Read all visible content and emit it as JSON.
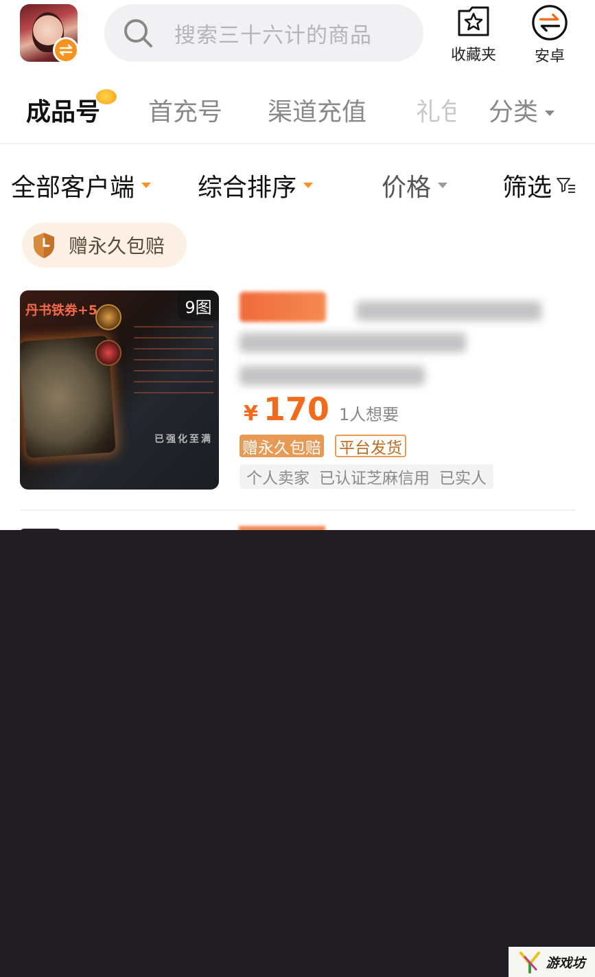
{
  "header": {
    "search_placeholder": "搜索三十六计的商品",
    "favorites_label": "收藏夹",
    "platform_label": "安卓"
  },
  "tabs": [
    {
      "label": "成品号",
      "active": true
    },
    {
      "label": "首充号",
      "active": false
    },
    {
      "label": "渠道充值",
      "active": false
    },
    {
      "label": "礼包",
      "active": false
    },
    {
      "label": "分类",
      "active": false
    }
  ],
  "filters": {
    "client": "全部客户端",
    "sort": "综合排序",
    "price": "价格",
    "filter": "筛选"
  },
  "guarantee_chip": "赠永久包赔",
  "listing": {
    "image_count": "9图",
    "image_header": "丹书铁券+5",
    "image_caption": "已强化至满",
    "currency": "¥",
    "price": "170",
    "wants": "1人想要",
    "badges": [
      "赠永久包赔",
      "平台发货"
    ],
    "seller_tags": [
      "个人卖家",
      "已认证芝麻信用",
      "已实人"
    ]
  },
  "watermark": "游戏坊",
  "colors": {
    "accent": "#f26a1b",
    "badge": "#e89a54",
    "overlay": "#211d22"
  }
}
